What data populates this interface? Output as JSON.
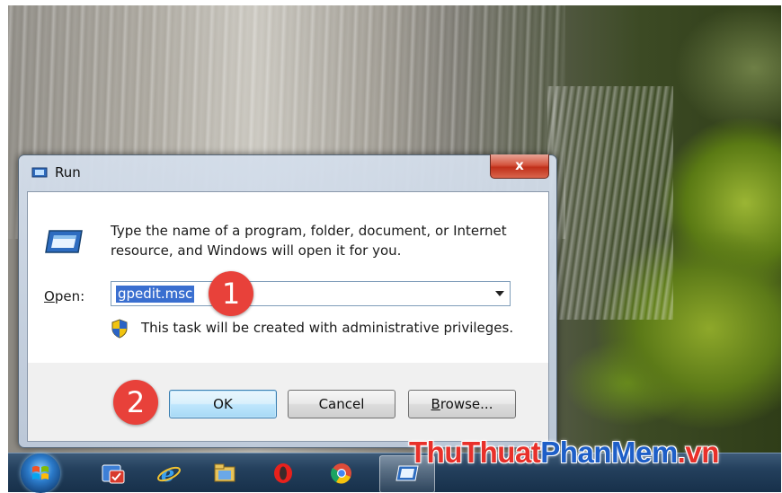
{
  "dialog": {
    "title": "Run",
    "close_label": "x",
    "description": "Type the name of a program, folder, document, or Internet resource, and Windows will open it for you.",
    "open_label_mnemonic": "O",
    "open_label_rest": "pen:",
    "open_value": "gpedit.msc",
    "admin_notice": "This task will be created with administrative privileges.",
    "ok_label": "OK",
    "cancel_label": "Cancel",
    "browse_label_mnemonic": "B",
    "browse_label_rest": "rowse..."
  },
  "annotations": {
    "step1": "1",
    "step2": "2"
  },
  "watermark": {
    "part1": "ThuThuat",
    "part2": "PhanMem",
    "part3": ".vn"
  },
  "taskbar": {
    "items": [
      "start-orb",
      "security-app-icon",
      "internet-explorer-icon",
      "file-explorer-icon",
      "opera-icon",
      "chrome-icon",
      "run-icon"
    ]
  },
  "colors": {
    "selection": "#3a6fd0",
    "badge": "#e8413a",
    "close_button": "#c0301a",
    "watermark_red": "#e8302a",
    "watermark_blue": "#1e5fc8"
  }
}
